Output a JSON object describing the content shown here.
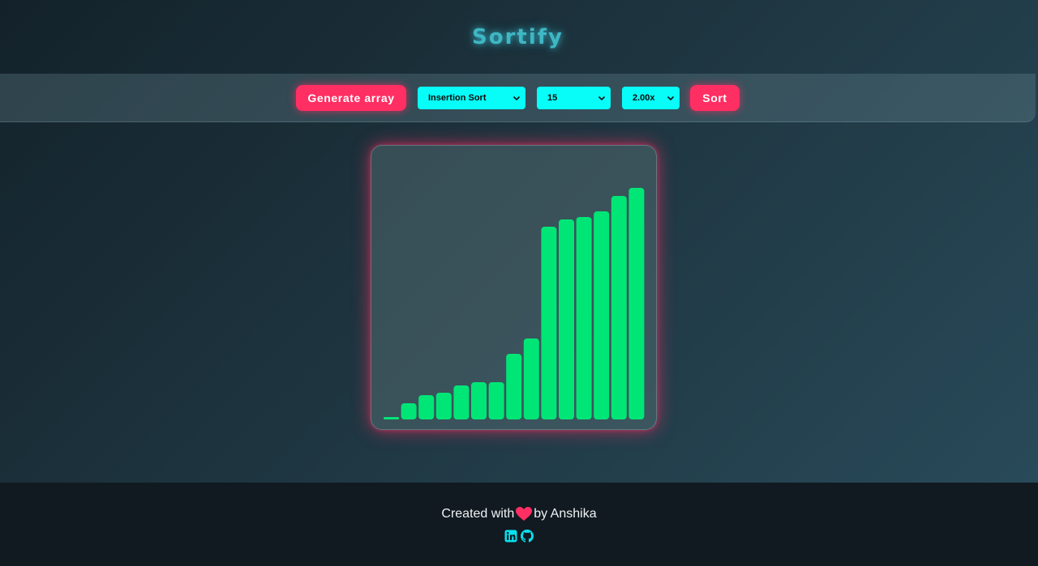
{
  "header": {
    "title": "Sortify"
  },
  "toolbar": {
    "generate_label": "Generate array",
    "algorithm": "Insertion Sort",
    "array_size": "15",
    "speed": "2.00x",
    "sort_label": "Sort"
  },
  "chart_data": {
    "type": "bar",
    "values": [
      3,
      20,
      30,
      33,
      42,
      46,
      46,
      81,
      100,
      238,
      247,
      250,
      257,
      276,
      286
    ],
    "bar_color": "#00e676"
  },
  "footer": {
    "created_prefix": "Created with",
    "created_suffix": "by Anshika",
    "icons": [
      "heart-icon",
      "linkedin-icon",
      "github-icon"
    ]
  },
  "colors": {
    "accent": "#ff2e63",
    "control_bg": "#08fdf8",
    "title_glow": "#3fb7c4",
    "footer_bg": "#111a21"
  }
}
